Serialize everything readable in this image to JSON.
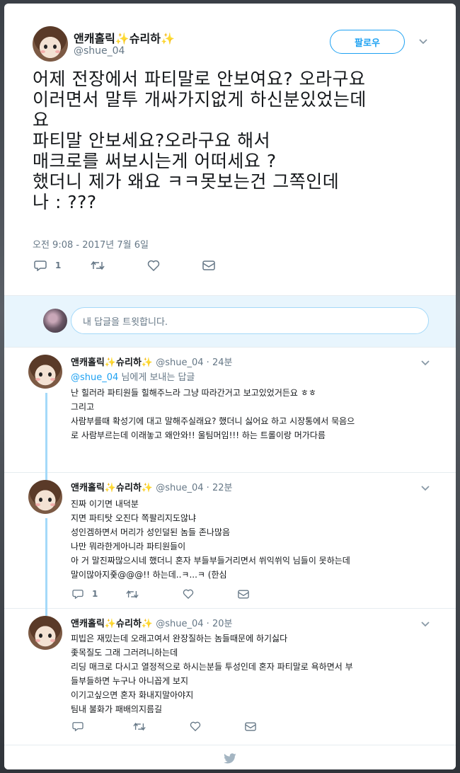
{
  "main_tweet": {
    "display_name": "앤캐홀릭✨슈리하✨",
    "handle": "@shue_04",
    "follow_label": "팔로우",
    "text_lines": [
      "어제 전장에서 파티말로 안보여요? 오라구요",
      "이러면서 말투 개싸가지없게 하신분있었는데",
      "요",
      "파티말 안보세요?오라구요 해서",
      "매크로를 써보시는게 어떠세요 ?",
      "했더니 제가 왜요 ㅋㅋ못보는건 그쪽인데",
      "나  : ???"
    ],
    "timestamp": "오전 9:08 - 2017년 7월 6일",
    "reply_count": "1"
  },
  "reply_box": {
    "placeholder": "내 답글을 트윗합니다."
  },
  "replies": [
    {
      "display_name": "앤캐홀릭✨슈리하✨",
      "handle": "@shue_04",
      "ago": "24분",
      "mention": "@shue_04",
      "to_suffix": " 님에게 보내는 답글",
      "lines": [
        "난 힐러라 파티원들 힐해주느라 그냥 따라간거고 보고있었거든요 ㅎㅎ",
        "그리고",
        "사람부를때 확성기에 대고 말해주실래요? 했더니 싫어요 하고 시장통에서 묵음으",
        "로 사람부르는데 이래놓고 왜안와!! 울팀머임!!! 하는 트롤이랑 머가다름"
      ]
    },
    {
      "display_name": "앤캐홀릭✨슈리하✨",
      "handle": "@shue_04",
      "ago": "22분",
      "lines": [
        "진짜 이기면 내덕분",
        "지면 파티탓 오진다 쪽팔리지도않냐",
        "성인겜하면서 머리가 성인덜된 놈들 존나많음",
        "나만 뭐라한게아니라 파티원들이",
        "아 거 말진짜많으시네 했더니 혼자 부들부들거리면서 쒸익쒸익 님들이 못하는데",
        "말이많아지죷@@@!! 하는데..ㅋ...ㅋ (한심"
      ],
      "reply_count": "1"
    },
    {
      "display_name": "앤캐홀릭✨슈리하✨",
      "handle": "@shue_04",
      "ago": "20분",
      "lines": [
        "피빕은 재밌는데 오래고여서 완장질하는 놈들때문에 하기싫다",
        "좇목질도 그래 그러려니하는데",
        "리딩 매크로 다시고 열정적으로 하시는분들 투성인데 혼자 파티말로 욕하면서 부",
        "들부들하면 누구나 아니꼽게 보지",
        "이기고싶으면 혼자 화내지말아야지",
        "팀내 불화가 패배의지름길"
      ]
    }
  ],
  "colors": {
    "accent": "#1da1f2",
    "secondary_text": "#657786",
    "reply_bar_bg": "#e8f5fd",
    "thread_line": "#a4d9f9"
  },
  "icons": [
    "reply-icon",
    "retweet-icon",
    "like-icon",
    "dm-icon",
    "caret-down-icon",
    "twitter-bird-icon"
  ]
}
